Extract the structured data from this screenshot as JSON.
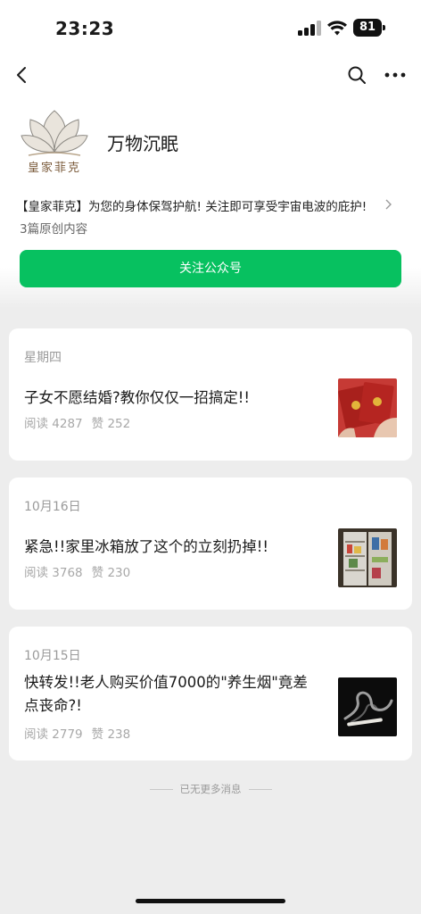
{
  "status_bar": {
    "time": "23:23",
    "battery": "81"
  },
  "account": {
    "name": "万物沉眠",
    "avatar_text": "皇家菲克",
    "intro": "【皇家菲克】为您的身体保驾护航! 关注即可享受宇宙电波的庇护!",
    "original_count": "3篇原创内容",
    "follow_label": "关注公众号"
  },
  "articles": [
    {
      "date": "星期四",
      "title": "子女不愿结婚?教你仅仅一招搞定!!",
      "reads": "阅读 4287",
      "likes": "赞 252"
    },
    {
      "date": "10月16日",
      "title": "紧急!!家里冰箱放了这个的立刻扔掉!!",
      "reads": "阅读 3768",
      "likes": "赞 230"
    },
    {
      "date": "10月15日",
      "title": "快转发!!老人购买价值7000的\"养生烟\"竟差点丧命?!",
      "reads": "阅读 2779",
      "likes": "赞 238"
    }
  ],
  "footer": {
    "no_more": "已无更多消息"
  },
  "colors": {
    "accent": "#07c160",
    "background": "#ededed"
  },
  "icons": {
    "back": "chevron-left-icon",
    "search": "search-icon",
    "more": "more-dots-icon"
  }
}
